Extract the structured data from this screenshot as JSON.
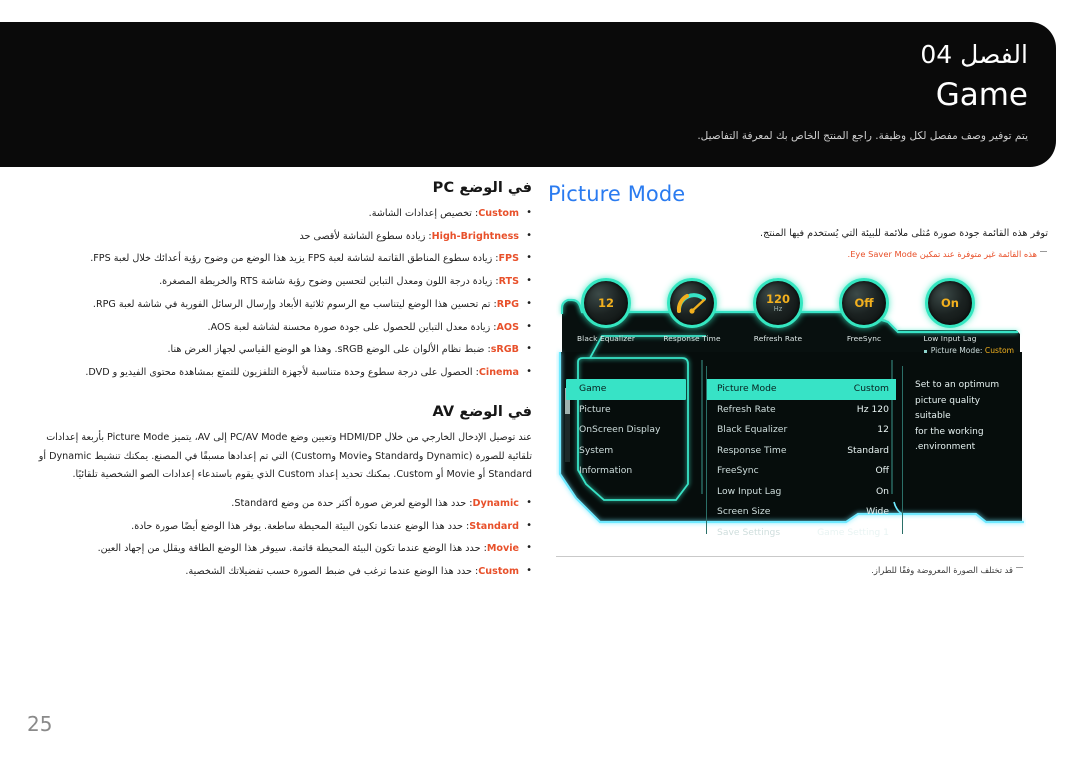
{
  "header": {
    "chapter": "الفصل 04",
    "title": "Game",
    "subtitle": "يتم توفير وصف مفصل لكل وظيفة. راجع المنتج الخاص بك لمعرفة التفاصيل."
  },
  "left": {
    "pc_heading": "في الوضع PC",
    "pc_items": [
      {
        "kw": "Custom",
        "text": ": تخصيص إعدادات الشاشة."
      },
      {
        "kw": "High-Brightness",
        "text": ": زيادة سطوع الشاشة لأقصى حد"
      },
      {
        "kw": "FPS",
        "text": ": زيادة سطوع المناطق القاتمة لشاشة لعبة FPS يزيد هذا الوضع من وضوح رؤية أعدائك خلال لعبة FPS."
      },
      {
        "kw": "RTS",
        "text": ": زيادة درجة اللون ومعدل التباين لتحسين وضوح رؤية شاشة RTS والخريطة المصغرة."
      },
      {
        "kw": "RPG",
        "text": ": تم تحسين هذا الوضع ليتناسب مع الرسوم ثلاثية الأبعاد وإرسال الرسائل الفورية في شاشة لعبة RPG."
      },
      {
        "kw": "AOS",
        "text": ": زيادة معدل التباين للحصول على جودة صورة محسنة لشاشة لعبة AOS."
      },
      {
        "kw": "sRGB",
        "text": ": ضبط نظام الألوان على الوضع sRGB. وهذا هو الوضع القياسي لجهاز العرض هنا."
      },
      {
        "kw": "Cinema",
        "text": ": الحصول على درجة سطوع وحدة متناسبة لأجهزة التلفزيون للتمتع بمشاهدة محتوى الفيديو و DVD."
      }
    ],
    "av_heading": "في الوضع AV",
    "av_paragraph": "عند توصيل الإدخال الخارجي من خلال HDMI/DP وتعيين وضع PC/AV Mode إلى AV، يتميز Picture Mode بأربعة إعدادات تلقائية للصورة (Dynamic وStandard وMovie وCustom) التي تم إعدادها مسبقًا في المصنع. يمكنك تنشيط Dynamic أو Standard أو Movie أو Custom. بمكنك تحديد إعداد Custom الذي يقوم باستدعاء إعدادات الصو الشخصية تلقائيًا.",
    "av_items": [
      {
        "kw": "Dynamic",
        "text": ": حدد هذا الوضع لعرض صورة أكثر حدة من وضع Standard."
      },
      {
        "kw": "Standard",
        "text": ": حدد هذا الوضع عندما تكون البيئة المحيطة ساطعة. يوفر هذا الوضع أيضًا صورة حادة."
      },
      {
        "kw": "Movie",
        "text": ": حدد هذا الوضع عندما تكون البيئة المحيطة قاتمة. سيوفر هذا الوضع الطاقة ويقلل من إجهاد العين."
      },
      {
        "kw": "Custom",
        "text": ": حدد هذا الوضع عندما ترغب في ضبط الصورة حسب تفضيلاتك الشخصية."
      }
    ]
  },
  "right": {
    "picture_mode_title": "Picture Mode",
    "description": "توفر هذه القائمة جودة صورة مُثلى ملائمة للبيئة التي يُستخدم فيها المنتج.",
    "note": "هذه القائمة غير متوفرة عند تمكين Eye Saver Mode.",
    "footnote": "قد تختلف الصورة المعروضة وفقًا للطراز."
  },
  "osd": {
    "dials": [
      {
        "value": "12",
        "unit": "",
        "label": "Black Equalizer",
        "type": "number"
      },
      {
        "value": "",
        "unit": "",
        "label": "Response Time",
        "type": "needle"
      },
      {
        "value": "120",
        "unit": "Hz",
        "label": "Refresh Rate",
        "type": "number"
      },
      {
        "value": "Off",
        "unit": "",
        "label": "FreeSync",
        "type": "number"
      },
      {
        "value": "On",
        "unit": "",
        "label": "Low Input Lag",
        "type": "number"
      }
    ],
    "breadcrumb_label": "Picture Mode:",
    "breadcrumb_value": "Custom",
    "menu": [
      {
        "label": "Game",
        "active": true
      },
      {
        "label": "Picture",
        "active": false
      },
      {
        "label": "OnScreen Display",
        "active": false
      },
      {
        "label": "System",
        "active": false
      },
      {
        "label": "Information",
        "active": false
      }
    ],
    "settings": [
      {
        "key": "Picture Mode",
        "value": "Custom",
        "active": true
      },
      {
        "key": "Refresh Rate",
        "value": "Hz 120",
        "active": false
      },
      {
        "key": "Black Equalizer",
        "value": "12",
        "active": false
      },
      {
        "key": "Response Time",
        "value": "Standard",
        "active": false
      },
      {
        "key": "FreeSync",
        "value": "Off",
        "active": false
      },
      {
        "key": "Low Input Lag",
        "value": "On",
        "active": false
      },
      {
        "key": "Screen Size",
        "value": "Wide",
        "active": false
      },
      {
        "key": "Save Settings",
        "value": "Game Setting 1",
        "active": false
      }
    ],
    "help": [
      "Set to an optimum",
      "picture quality suitable",
      "for the working",
      ".environment"
    ]
  },
  "page_number": "25",
  "colors": {
    "accent_blue": "#2a7bf0",
    "keyword_orange": "#e8502a",
    "osd_teal": "#37e3c6",
    "osd_amber": "#f2b01e",
    "header_black": "#0a0a0a"
  }
}
